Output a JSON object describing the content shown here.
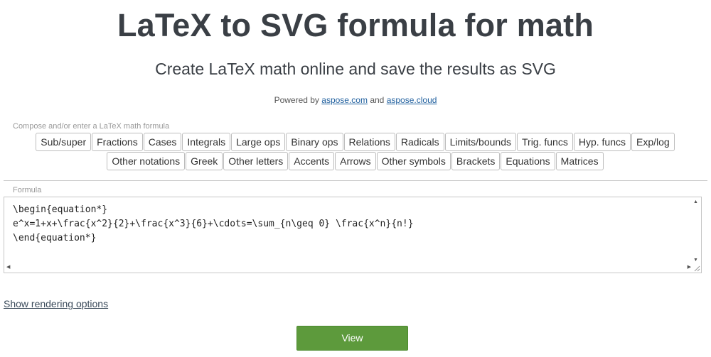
{
  "header": {
    "title": "LaTeX to SVG formula for math",
    "subtitle": "Create LaTeX math online and save the results as SVG",
    "powered_prefix": "Powered by",
    "link1": "aspose.com",
    "powered_and": "and",
    "link2": "aspose.cloud"
  },
  "compose": {
    "label": "Compose and/or enter a LaTeX math formula",
    "row1": [
      "Sub/super",
      "Fractions",
      "Cases",
      "Integrals",
      "Large ops",
      "Binary ops",
      "Relations",
      "Radicals",
      "Limits/bounds",
      "Trig. funcs",
      "Hyp. funcs",
      "Exp/log"
    ],
    "row2": [
      "Other notations",
      "Greek",
      "Other letters",
      "Accents",
      "Arrows",
      "Other symbols",
      "Brackets",
      "Equations",
      "Matrices"
    ]
  },
  "formula": {
    "label": "Formula",
    "value": "\\begin{equation*}\ne^x=1+x+\\frac{x^2}{2}+\\frac{x^3}{6}+\\cdots=\\sum_{n\\geq 0} \\frac{x^n}{n!}\n\\end{equation*}"
  },
  "options": {
    "show_rendering": "Show rendering options"
  },
  "actions": {
    "view": "View"
  },
  "colors": {
    "accent_green": "#5d9a3c",
    "link_blue": "#1f5f9e"
  }
}
